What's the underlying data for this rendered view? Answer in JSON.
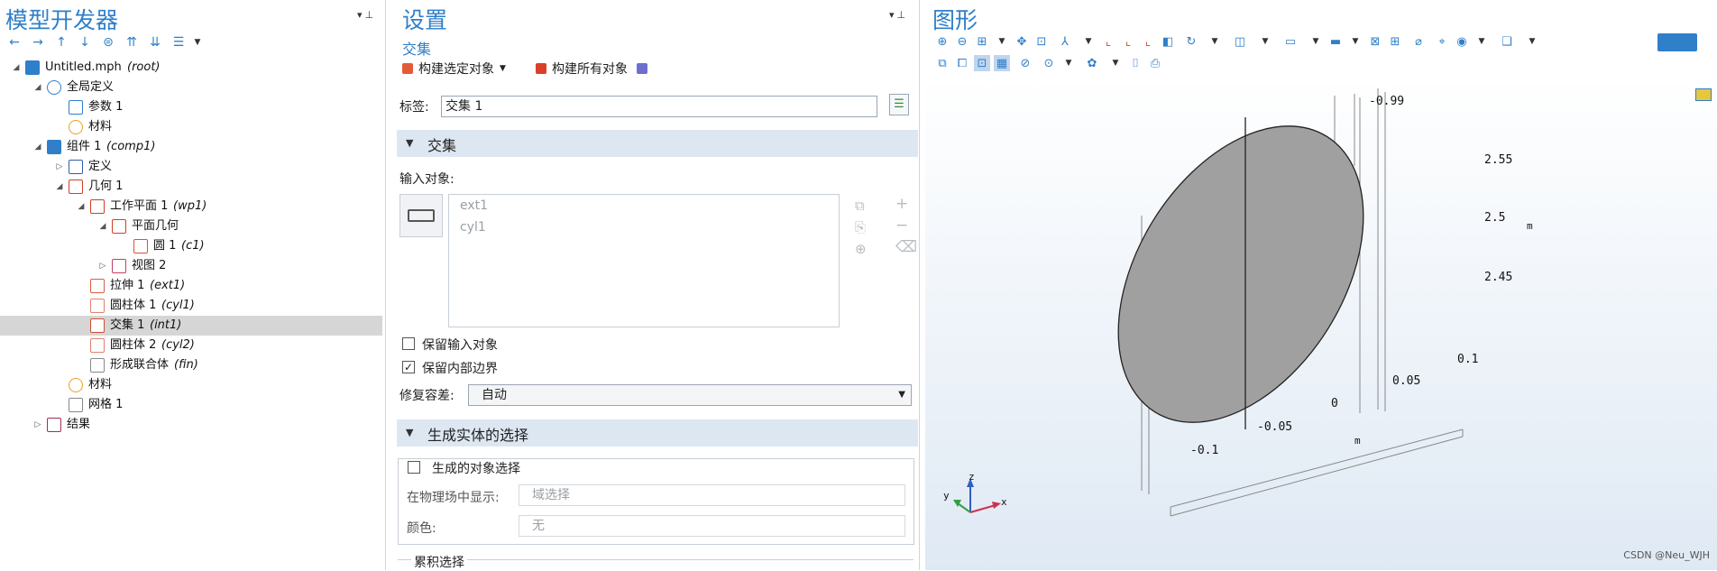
{
  "model_builder": {
    "title": "模型开发器",
    "tree": [
      {
        "label": "Untitled.mph",
        "tag": "(root)",
        "icon": "mph-file-icon",
        "expander": "expanded"
      },
      {
        "label": "全局定义",
        "tag": "",
        "icon": "globe-icon",
        "expander": "expanded"
      },
      {
        "label": "参数 1",
        "tag": "",
        "icon": "parameters-icon",
        "expander": ""
      },
      {
        "label": "材料",
        "tag": "",
        "icon": "materials-icon",
        "expander": ""
      },
      {
        "label": "组件 1",
        "tag": "(comp1)",
        "icon": "component-icon",
        "expander": "expanded"
      },
      {
        "label": "定义",
        "tag": "",
        "icon": "definitions-icon",
        "expander": "collapsed"
      },
      {
        "label": "几何 1",
        "tag": "",
        "icon": "geometry-icon",
        "expander": "expanded"
      },
      {
        "label": "工作平面 1",
        "tag": "(wp1)",
        "icon": "workplane-icon",
        "expander": "expanded"
      },
      {
        "label": "平面几何",
        "tag": "",
        "icon": "plane-geometry-icon",
        "expander": "expanded"
      },
      {
        "label": "圆 1",
        "tag": "(c1)",
        "icon": "circle-icon",
        "expander": ""
      },
      {
        "label": "视图 2",
        "tag": "",
        "icon": "view-icon",
        "expander": "collapsed"
      },
      {
        "label": "拉伸 1",
        "tag": "(ext1)",
        "icon": "extrude-icon",
        "expander": ""
      },
      {
        "label": "圆柱体 1",
        "tag": "(cyl1)",
        "icon": "cylinder-icon",
        "expander": ""
      },
      {
        "label": "交集 1",
        "tag": "(int1)",
        "icon": "intersection-icon",
        "expander": "",
        "selected": true
      },
      {
        "label": "圆柱体 2",
        "tag": "(cyl2)",
        "icon": "cylinder-icon",
        "expander": ""
      },
      {
        "label": "形成联合体",
        "tag": "(fin)",
        "icon": "form-union-icon",
        "expander": ""
      },
      {
        "label": "材料",
        "tag": "",
        "icon": "materials-icon",
        "expander": ""
      },
      {
        "label": "网格 1",
        "tag": "",
        "icon": "mesh-icon",
        "expander": ""
      },
      {
        "label": "结果",
        "tag": "",
        "icon": "results-icon",
        "expander": "collapsed"
      }
    ]
  },
  "settings": {
    "title": "设置",
    "subtitle": "交集",
    "build_selected": "构建选定对象",
    "build_all": "构建所有对象",
    "label_field_label": "标签:",
    "label_field_value": "交集 1",
    "section_intersection": "交集",
    "input_objects_label": "输入对象:",
    "input_objects": [
      "ext1",
      "cyl1"
    ],
    "keep_input_label": "保留输入对象",
    "keep_input_checked": false,
    "keep_interior_label": "保留内部边界",
    "keep_interior_checked": true,
    "repair_tolerance_label": "修复容差:",
    "repair_tolerance_value": "自动",
    "section_selections": "生成实体的选择",
    "resulting_selection_label": "生成的对象选择",
    "show_in_physics_label": "在物理场中显示:",
    "show_in_physics_value": "域选择",
    "color_label": "颜色:",
    "color_value": "无",
    "cumulative_label": "累积选择"
  },
  "graphics": {
    "title": "图形",
    "axis_labels": {
      "z_top": "-0.99",
      "z_ticks": [
        "2.55",
        "2.5",
        "2.45"
      ],
      "z_unit": "m",
      "y_ticks": [
        "0.1",
        "0.05",
        "0",
        "-0.05",
        "-0.1"
      ],
      "y_unit": "m"
    },
    "triad": {
      "x": "x",
      "y": "y",
      "z": "z"
    },
    "watermark": "CSDN @Neu_WJH"
  },
  "colors": {
    "accent": "#2f7fc9",
    "section_bg": "#dde7f2",
    "selected_row": "#d6d6d6",
    "shape_fill": "#a0a0a0",
    "graphics_bg_top": "#ffffff",
    "graphics_bg_bottom": "#dfe9f4"
  }
}
